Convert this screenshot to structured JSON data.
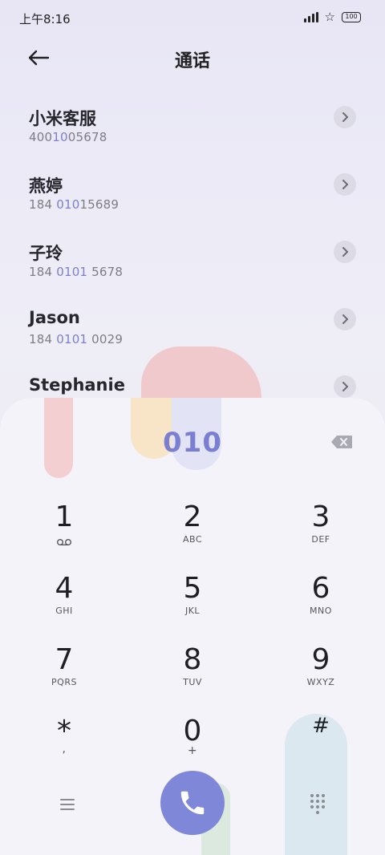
{
  "status": {
    "time": "上午8:16",
    "battery": "100"
  },
  "header": {
    "title": "通话",
    "back_icon": "arrow-left-icon"
  },
  "contacts": [
    {
      "name": "小米客服",
      "number_pre": "400",
      "number_hl": "10",
      "number_post": "05678"
    },
    {
      "name": "燕婷",
      "number_pre": "184 ",
      "number_hl": "010",
      "number_post": "15689"
    },
    {
      "name": "子玲",
      "number_pre": "184 ",
      "number_hl": "0101",
      "number_post": " 5678"
    },
    {
      "name": "Jason",
      "number_pre": "184 ",
      "number_hl": "0101",
      "number_post": " 0029"
    },
    {
      "name": "Stephanie",
      "number_pre": "",
      "number_hl": "",
      "number_post": ""
    }
  ],
  "dialpad": {
    "input": "010",
    "keys": [
      {
        "digit": "1",
        "sub": ""
      },
      {
        "digit": "2",
        "sub": "ABC"
      },
      {
        "digit": "3",
        "sub": "DEF"
      },
      {
        "digit": "4",
        "sub": "GHI"
      },
      {
        "digit": "5",
        "sub": "JKL"
      },
      {
        "digit": "6",
        "sub": "MNO"
      },
      {
        "digit": "7",
        "sub": "PQRS"
      },
      {
        "digit": "8",
        "sub": "TUV"
      },
      {
        "digit": "9",
        "sub": "WXYZ"
      },
      {
        "digit": "*",
        "sub": ","
      },
      {
        "digit": "0",
        "sub": "+"
      },
      {
        "digit": "#",
        "sub": ""
      }
    ]
  },
  "colors": {
    "accent": "#7b7fd1",
    "call_button": "#7f87d8"
  }
}
